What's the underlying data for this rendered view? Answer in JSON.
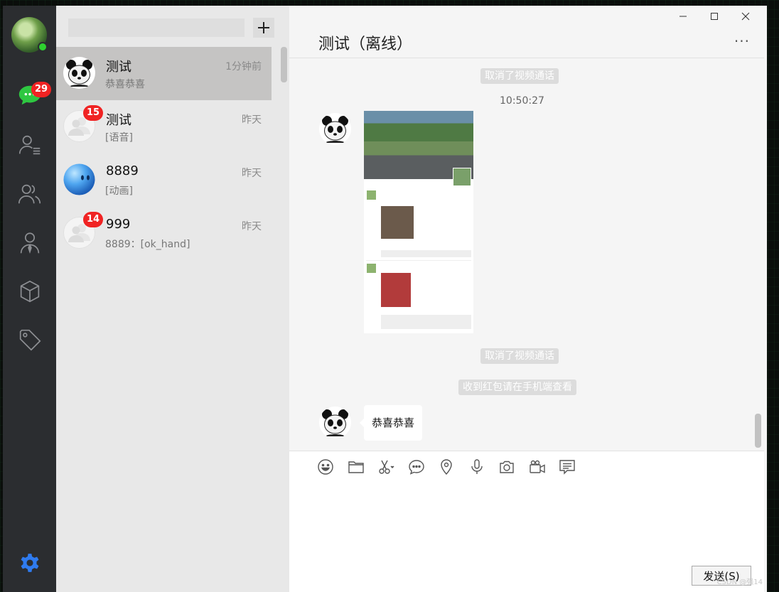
{
  "colors": {
    "rail_bg": "#2b2d30",
    "list_bg": "#e8e8e8",
    "active_row": "#c5c4c3",
    "badge": "#f02323",
    "online": "#2ed12f",
    "settings_icon": "#2f7bef",
    "chat_icon": "#2ec741"
  },
  "rail": {
    "chat_badge": "29",
    "items": [
      {
        "icon": "chat-bubble-icon"
      },
      {
        "icon": "contacts-list-icon"
      },
      {
        "icon": "group-icon"
      },
      {
        "icon": "person-tie-icon"
      },
      {
        "icon": "cube-icon"
      },
      {
        "icon": "tag-icon"
      }
    ],
    "settings_icon": "gear-icon"
  },
  "search": {
    "value": "",
    "placeholder": ""
  },
  "conversations": [
    {
      "name": "测试",
      "time": "1分钟前",
      "preview": "恭喜恭喜",
      "badge": "",
      "avatar": "panda"
    },
    {
      "name": "测试",
      "time": "昨天",
      "preview": "[语音]",
      "badge": "15",
      "avatar": "group"
    },
    {
      "name": "8889",
      "time": "昨天",
      "preview": "[动画]",
      "badge": "",
      "avatar": "blue-ball"
    },
    {
      "name": "999",
      "time": "昨天",
      "preview": "8889：[ok_hand]",
      "badge": "14",
      "avatar": "group"
    }
  ],
  "chat": {
    "title": "测试（离线）",
    "more": "···",
    "messages": {
      "sys1": "取消了视频通话",
      "timestamp": "10:50:27",
      "sys2": "取消了视频通话",
      "sys3": "收到红包请在手机端查看",
      "text": "恭喜恭喜"
    },
    "send_label": "发送(S)",
    "watermark": "CSDN @强14"
  },
  "toolbar": [
    "emoji-icon",
    "folder-icon",
    "scissors-icon",
    "speech-bubble-icon",
    "location-pin-icon",
    "microphone-icon",
    "camera-icon",
    "video-camera-icon",
    "message-list-icon"
  ]
}
